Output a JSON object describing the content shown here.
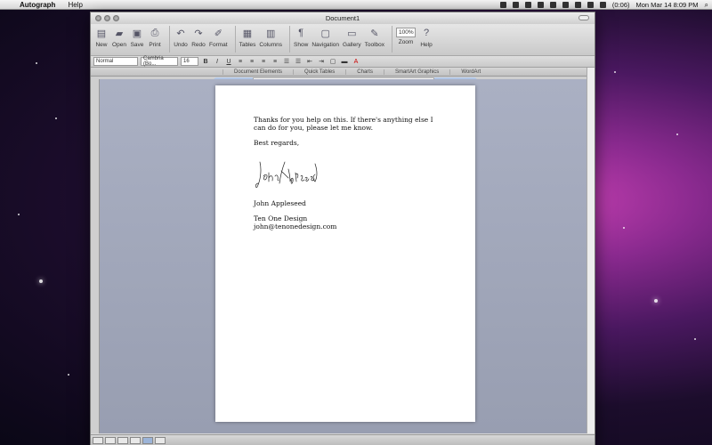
{
  "menubar": {
    "app_name": "Autograph",
    "menus": [
      "Help"
    ],
    "status": {
      "battery": "(0:06)",
      "clock": "Mon Mar 14  8:09 PM"
    }
  },
  "window": {
    "title": "Document1"
  },
  "toolbar": {
    "buttons": [
      {
        "label": "New",
        "icon": "new-doc-icon",
        "glyph": "▤"
      },
      {
        "label": "Open",
        "icon": "open-icon",
        "glyph": "📂"
      },
      {
        "label": "Save",
        "icon": "save-icon",
        "glyph": "▣"
      },
      {
        "label": "Print",
        "icon": "print-icon",
        "glyph": "⎙"
      },
      {
        "label": "Undo",
        "icon": "undo-icon",
        "glyph": "↶"
      },
      {
        "label": "Redo",
        "icon": "redo-icon",
        "glyph": "↷"
      },
      {
        "label": "Format",
        "icon": "format-icon",
        "glyph": "🖌"
      },
      {
        "label": "Tables",
        "icon": "tables-icon",
        "glyph": "▦"
      },
      {
        "label": "Columns",
        "icon": "columns-icon",
        "glyph": "▥"
      },
      {
        "label": "Show",
        "icon": "pilcrow-icon",
        "glyph": "¶"
      },
      {
        "label": "Navigation",
        "icon": "navigation-icon",
        "glyph": "▢"
      },
      {
        "label": "Gallery",
        "icon": "gallery-icon",
        "glyph": "▭"
      },
      {
        "label": "Toolbox",
        "icon": "toolbox-icon",
        "glyph": "✎"
      }
    ],
    "zoom_value": "100%",
    "zoom_label": "Zoom",
    "help_label": "Help"
  },
  "format_bar": {
    "style": "Normal",
    "font": "Cambria (Bo...",
    "size": "16"
  },
  "ribbon_tabs": [
    "Document Elements",
    "Quick Tables",
    "Charts",
    "SmartArt Graphics",
    "WordArt"
  ],
  "document": {
    "para1": "Thanks for you help on this.  If there's anything else I can do for you, please let me know.",
    "para2": "Best regards,",
    "signature_text": "John Appleseed",
    "name": "John Appleseed",
    "company": "Ten One Design",
    "email": "john@tenonedesign.com"
  }
}
